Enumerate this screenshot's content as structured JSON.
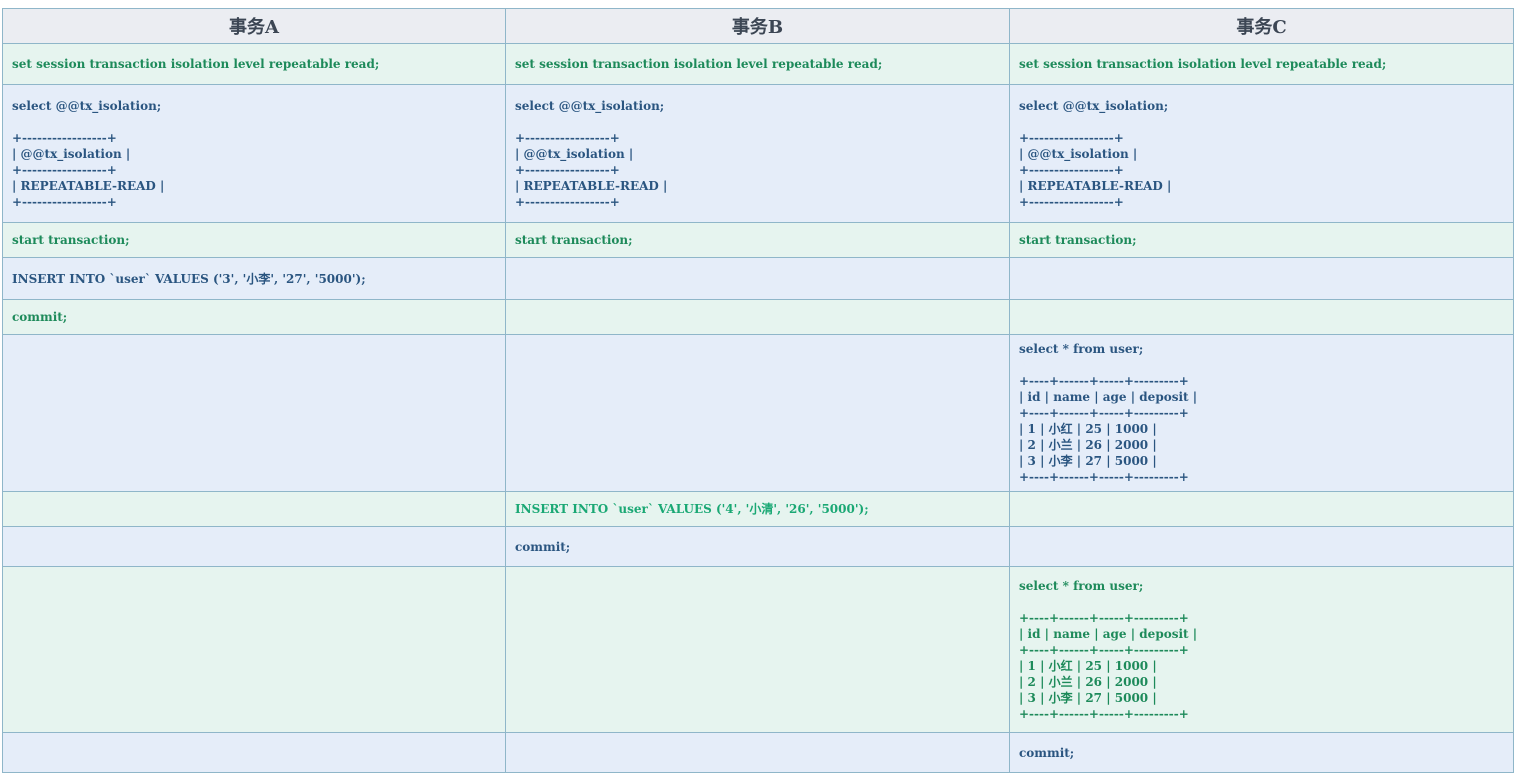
{
  "headers": [
    "事务A",
    "事务B",
    "事务C"
  ],
  "rows": [
    [
      "set session transaction isolation level repeatable read;",
      "set session transaction isolation level repeatable read;",
      "set session transaction isolation level repeatable read;"
    ],
    [
      "select @@tx_isolation;\n\n+-----------------+\n| @@tx_isolation |\n+-----------------+\n| REPEATABLE-READ |\n+-----------------+",
      "select @@tx_isolation;\n\n+-----------------+\n| @@tx_isolation |\n+-----------------+\n| REPEATABLE-READ |\n+-----------------+",
      "select @@tx_isolation;\n\n+-----------------+\n| @@tx_isolation |\n+-----------------+\n| REPEATABLE-READ |\n+-----------------+"
    ],
    [
      "start transaction;",
      "start transaction;",
      "start transaction;"
    ],
    [
      "INSERT INTO `user` VALUES ('3', '小李', '27', '5000');",
      "",
      ""
    ],
    [
      "commit;",
      "",
      ""
    ],
    [
      "",
      "",
      "select * from user;\n\n+----+------+-----+---------+\n| id | name | age | deposit |\n+----+------+-----+---------+\n| 1 | 小红 | 25 | 1000 |\n| 2 | 小兰 | 26 | 2000 |\n| 3 | 小李 | 27 | 5000 |\n+----+------+-----+---------+"
    ],
    [
      "",
      "INSERT INTO `user` VALUES ('4', '小清', '26', '5000');",
      ""
    ],
    [
      "",
      "commit;",
      ""
    ],
    [
      "",
      "",
      "select * from user;\n\n+----+------+-----+---------+\n| id | name | age | deposit |\n+----+------+-----+---------+\n| 1 | 小红 | 25 | 1000 |\n| 2 | 小兰 | 26 | 2000 |\n| 3 | 小李 | 27 | 5000 |\n+----+------+-----+---------+"
    ],
    [
      "",
      "",
      "commit;"
    ]
  ]
}
